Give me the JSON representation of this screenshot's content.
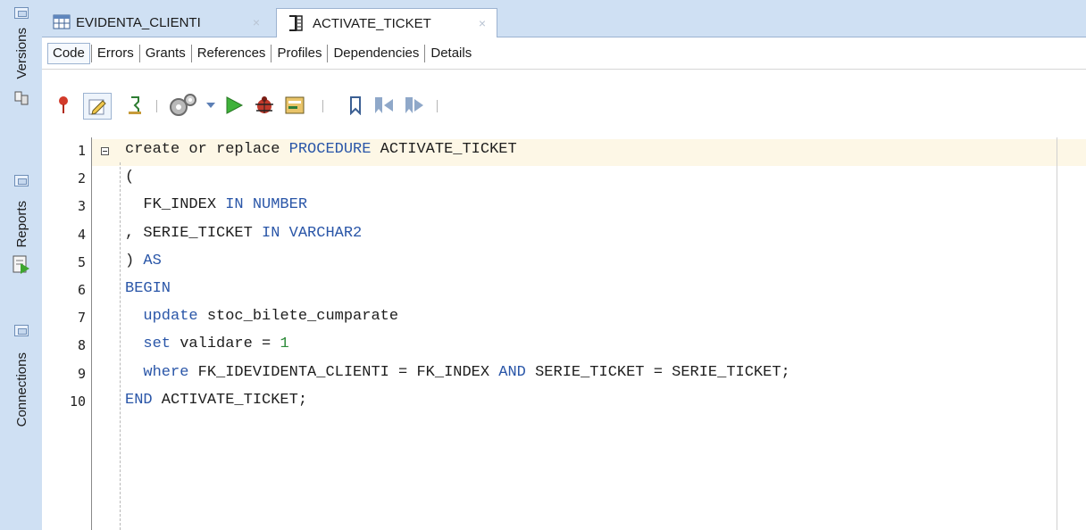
{
  "side_panel": {
    "versions": "Versions",
    "reports": "Reports",
    "connections": "Connections"
  },
  "tabs": [
    {
      "label": "EVIDENTA_CLIENTI",
      "close": "×",
      "icon": "table-icon",
      "active": false
    },
    {
      "label": "ACTIVATE_TICKET",
      "close": "×",
      "icon": "procedure-icon",
      "active": true
    }
  ],
  "subtabs": [
    "Code",
    "Errors",
    "Grants",
    "References",
    "Profiles",
    "Dependencies",
    "Details"
  ],
  "toolbar": {
    "icons": [
      "pin-icon",
      "edit-icon",
      "compile-icon",
      "settings-icon",
      "dropdown-icon",
      "run-icon",
      "debug-icon",
      "profile-icon",
      "bookmark-icon",
      "prev-bookmark-icon",
      "next-bookmark-icon"
    ]
  },
  "editor": {
    "lines": [
      {
        "num": "1",
        "parts": [
          [
            "create or replace ",
            "p"
          ],
          [
            "PROCEDURE",
            "k"
          ],
          [
            " ACTIVATE_TICKET",
            "p"
          ]
        ]
      },
      {
        "num": "2",
        "parts": [
          [
            "(",
            "p"
          ]
        ]
      },
      {
        "num": "3",
        "parts": [
          [
            "  FK_INDEX ",
            "p"
          ],
          [
            "IN",
            "k"
          ],
          [
            " ",
            "p"
          ],
          [
            "NUMBER",
            "k"
          ]
        ]
      },
      {
        "num": "4",
        "parts": [
          [
            ", SERIE_TICKET ",
            "p"
          ],
          [
            "IN",
            "k"
          ],
          [
            " ",
            "p"
          ],
          [
            "VARCHAR2",
            "k"
          ]
        ]
      },
      {
        "num": "5",
        "parts": [
          [
            ") ",
            "p"
          ],
          [
            "AS",
            "k"
          ]
        ]
      },
      {
        "num": "6",
        "parts": [
          [
            "BEGIN",
            "k"
          ]
        ]
      },
      {
        "num": "7",
        "parts": [
          [
            "  ",
            "p"
          ],
          [
            "update",
            "k"
          ],
          [
            " stoc_bilete_cumparate",
            "p"
          ]
        ]
      },
      {
        "num": "8",
        "parts": [
          [
            "  ",
            "p"
          ],
          [
            "set",
            "k"
          ],
          [
            " validare = ",
            "p"
          ],
          [
            "1",
            "n"
          ]
        ]
      },
      {
        "num": "9",
        "parts": [
          [
            "  ",
            "p"
          ],
          [
            "where",
            "k"
          ],
          [
            " FK_IDEVIDENTA_CLIENTI = FK_INDEX ",
            "p"
          ],
          [
            "AND",
            "k"
          ],
          [
            " SERIE_TICKET = SERIE_TICKET;",
            "p"
          ]
        ]
      },
      {
        "num": "10",
        "parts": [
          [
            "END",
            "k"
          ],
          [
            " ACTIVATE_TICKET;",
            "p"
          ]
        ]
      }
    ]
  },
  "colors": {
    "keyword": "#2a56a8",
    "number": "#2e8b3a",
    "plain": "#1e1e1e",
    "current_line": "#fdf7e6",
    "panel": "#cfe0f3"
  }
}
